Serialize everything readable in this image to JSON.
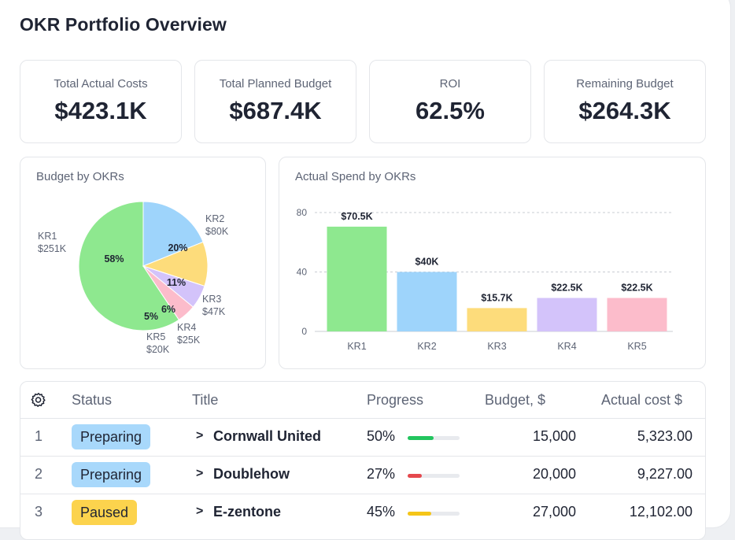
{
  "page": {
    "title": "OKR Portfolio Overview"
  },
  "kpis": [
    {
      "label": "Total Actual Costs",
      "value": "$423.1K"
    },
    {
      "label": "Total Planned Budget",
      "value": "$687.4K"
    },
    {
      "label": "ROI",
      "value": "62.5%"
    },
    {
      "label": "Remaining Budget",
      "value": "$264.3K"
    }
  ],
  "chart_data": [
    {
      "type": "pie",
      "title": "Budget by OKRs",
      "slices": [
        {
          "label": "KR1",
          "value_text": "$251K",
          "value": 251,
          "percent_text": "58%",
          "color": "#8ee88f"
        },
        {
          "label": "KR2",
          "value_text": "$80K",
          "value": 80,
          "percent_text": "20%",
          "color": "#9ed4fb"
        },
        {
          "label": "KR3",
          "value_text": "$47K",
          "value": 47,
          "percent_text": "11%",
          "color": "#fddc7b"
        },
        {
          "label": "KR4",
          "value_text": "$25K",
          "value": 25,
          "percent_text": "6%",
          "color": "#d3c3fa"
        },
        {
          "label": "KR5",
          "value_text": "$20K",
          "value": 20,
          "percent_text": "5%",
          "color": "#fcbccb"
        }
      ]
    },
    {
      "type": "bar",
      "title": "Actual Spend by OKRs",
      "categories": [
        "KR1",
        "KR2",
        "KR3",
        "KR4",
        "KR5"
      ],
      "values": [
        70.5,
        40,
        15.7,
        22.5,
        22.5
      ],
      "data_labels": [
        "$70.5K",
        "$40K",
        "$15.7K",
        "$22.5K",
        "$22.5K"
      ],
      "colors": [
        "#8ee88f",
        "#9ed4fb",
        "#fddc7b",
        "#d3c3fa",
        "#fcbccb"
      ],
      "yticks": [
        0,
        40,
        80
      ],
      "ylim": [
        0,
        80
      ],
      "grid": true
    }
  ],
  "table": {
    "settings_icon": "gear-icon",
    "headers": {
      "status": "Status",
      "title": "Title",
      "progress": "Progress",
      "budget": "Budget, $",
      "actual": "Actual cost $"
    },
    "rows": [
      {
        "index": "1",
        "status": "Preparing",
        "status_color": "#a8d8fb",
        "expand_icon": "chevron-right-icon",
        "title": "Cornwall United",
        "progress_text": "50%",
        "progress": 0.5,
        "progress_color": "#22c55e",
        "budget": "15,000",
        "actual": "5,323.00"
      },
      {
        "index": "2",
        "status": "Preparing",
        "status_color": "#a8d8fb",
        "expand_icon": "chevron-right-icon",
        "title": "Doublehow",
        "progress_text": "27%",
        "progress": 0.27,
        "progress_color": "#e5484d",
        "budget": "20,000",
        "actual": "9,227.00"
      },
      {
        "index": "3",
        "status": "Paused",
        "status_color": "#fcd34d",
        "expand_icon": "chevron-right-icon",
        "title": "E-zentone",
        "progress_text": "45%",
        "progress": 0.45,
        "progress_color": "#f5c518",
        "budget": "27,000",
        "actual": "12,102.00"
      }
    ]
  }
}
